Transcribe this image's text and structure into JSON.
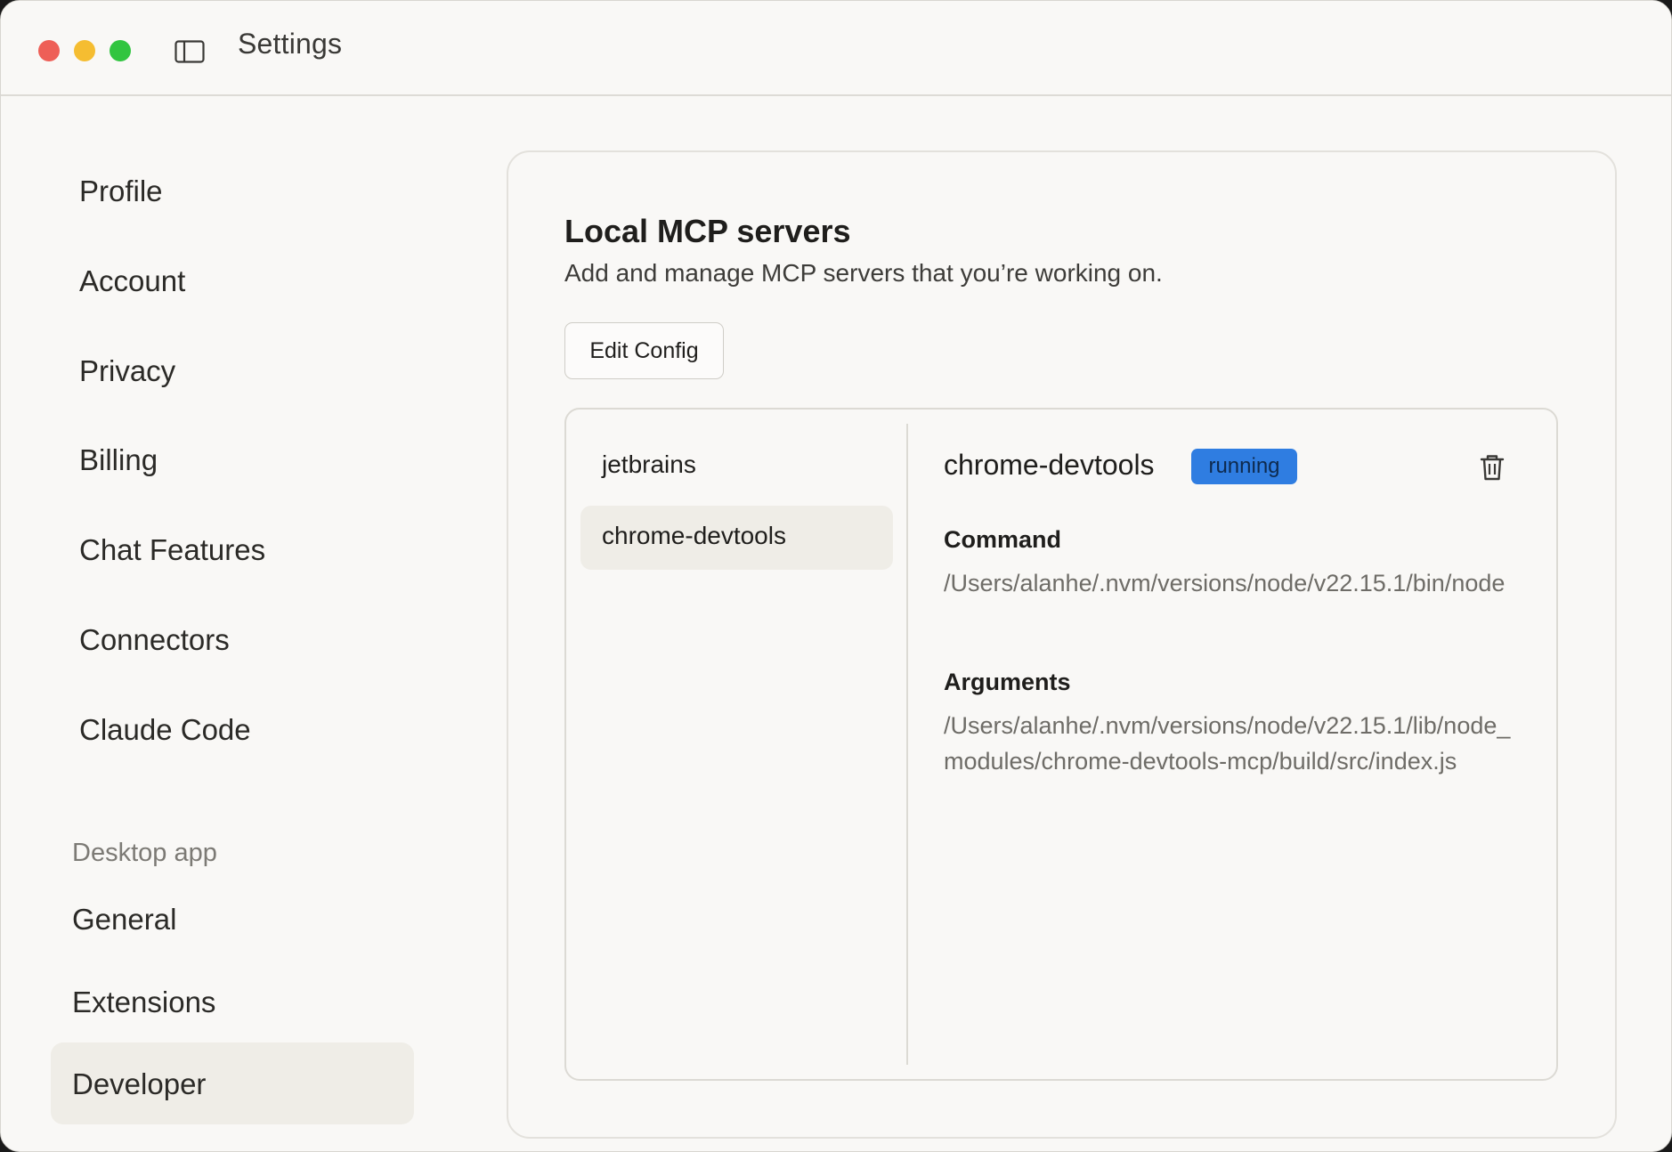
{
  "window": {
    "title": "Settings"
  },
  "sidebar": {
    "items": [
      {
        "label": "Profile"
      },
      {
        "label": "Account"
      },
      {
        "label": "Privacy"
      },
      {
        "label": "Billing"
      },
      {
        "label": "Chat Features"
      },
      {
        "label": "Connectors"
      },
      {
        "label": "Claude Code"
      }
    ],
    "desktop_section_label": "Desktop app",
    "desktop_items": [
      {
        "label": "General"
      },
      {
        "label": "Extensions"
      },
      {
        "label": "Developer",
        "active": true
      }
    ]
  },
  "main": {
    "title": "Local MCP servers",
    "subtitle": "Add and manage MCP servers that you’re working on.",
    "edit_config_label": "Edit Config",
    "servers": [
      {
        "name": "jetbrains"
      },
      {
        "name": "chrome-devtools",
        "selected": true
      }
    ],
    "detail": {
      "name": "chrome-devtools",
      "status": "running",
      "command_label": "Command",
      "command_value": "/Users/alanhe/.nvm/versions/node/v22.15.1/bin/node",
      "arguments_label": "Arguments",
      "arguments_value": "/Users/alanhe/.nvm/versions/node/v22.15.1/lib/node_modules/chrome-devtools-mcp/build/src/index.js"
    }
  },
  "colors": {
    "background": "#f9f8f6",
    "active_bg": "#efede7",
    "status_running": "#2f7de1",
    "traffic_red": "#ee5f57",
    "traffic_yellow": "#f5bd31",
    "traffic_green": "#31c540"
  },
  "icons": {
    "sidebar_toggle": "sidebar-toggle-icon",
    "trash": "trash-icon"
  }
}
